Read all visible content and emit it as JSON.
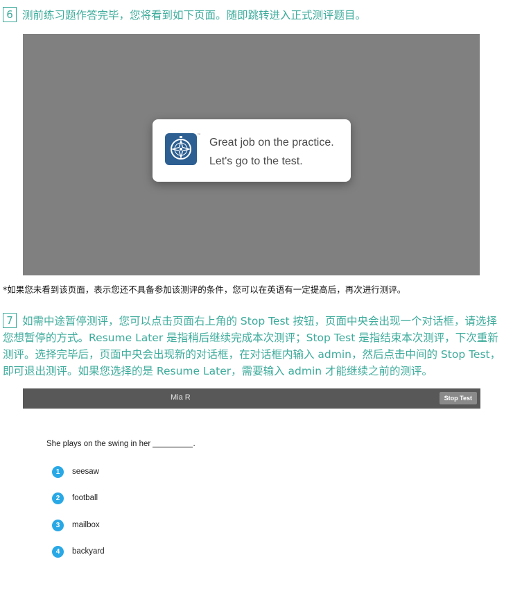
{
  "step6": {
    "number": "6",
    "text": "测前练习题作答完毕，您将看到如下页面。随即跳转进入正式测评题目。"
  },
  "toast": {
    "line1": "Great job on the practice.",
    "line2": "Let's go to the test.",
    "trademark": "™",
    "logo_icon": "compass-icon"
  },
  "note": "*如果您未看到该页面，表示您还不具备参加该测评的条件，您可以在英语有一定提高后，再次进行测评。",
  "step7": {
    "number": "7",
    "text": "如需中途暂停测评，您可以点击页面右上角的 Stop Test 按钮，页面中央会出现一个对话框，请选择您想暂停的方式。Resume Later 是指稍后继续完成本次测评；Stop Test 是指结束本次测评，下次重新测评。选择完毕后，页面中央会出现新的对话框，在对话框内输入 admin，然后点击中间的 Stop Test，即可退出测评。如果您选择的是 Resume Later，需要输入 admin 才能继续之前的测评。"
  },
  "test_screen": {
    "user_name": "Mia R",
    "stop_button": "Stop Test",
    "question_before": "She plays on the swing in her",
    "question_after": ".",
    "options": [
      {
        "num": "1",
        "label": "seesaw"
      },
      {
        "num": "2",
        "label": "football"
      },
      {
        "num": "3",
        "label": "mailbox"
      },
      {
        "num": "4",
        "label": "backyard"
      }
    ]
  },
  "colors": {
    "accent_teal": "#3dab9b",
    "option_blue": "#29a8e6",
    "overlay_gray": "#808080",
    "topbar": "#585858"
  }
}
